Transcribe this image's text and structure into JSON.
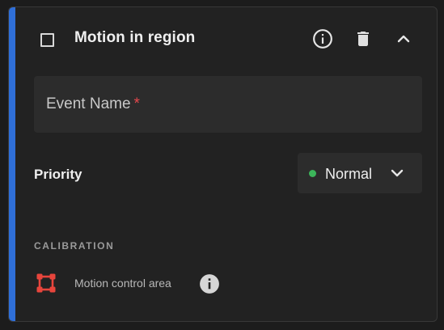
{
  "header": {
    "title": "Motion in region",
    "checked": false,
    "icons": [
      "checkbox-icon",
      "info-icon",
      "trash-icon",
      "chevron-up-icon"
    ]
  },
  "event_field": {
    "label": "Event Name",
    "required_marker": "*",
    "value": ""
  },
  "priority": {
    "label": "Priority",
    "selected": "Normal",
    "status_color": "#3cb55a",
    "icon": "chevron-down-icon"
  },
  "calibration": {
    "heading": "CALIBRATION",
    "item_label": "Motion control area",
    "item_icon": "region-select-icon",
    "info_icon": "info-icon"
  },
  "colors": {
    "accent": "#2f6fd8",
    "card_background": "#222222",
    "field_background": "#2c2c2c",
    "required": "#e5484d",
    "region_icon": "#e8453c"
  }
}
